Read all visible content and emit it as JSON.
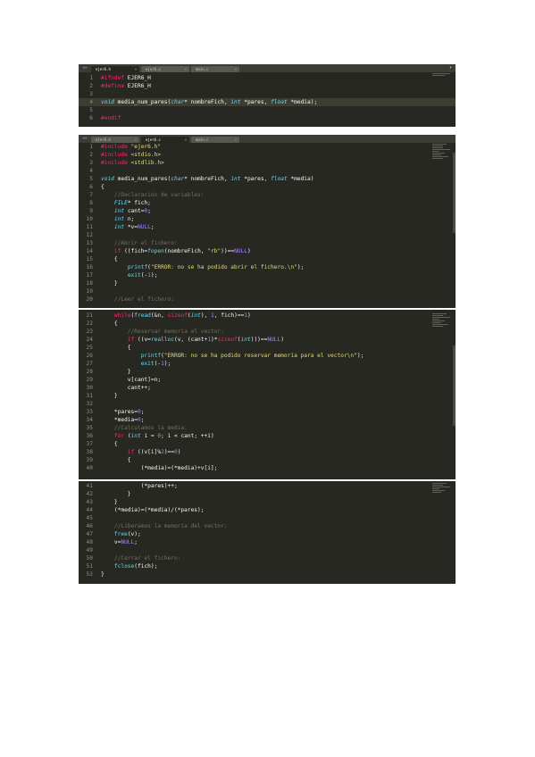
{
  "panels": [
    {
      "tabs": [
        "ejer6.h",
        "ejer6.c",
        "main.c"
      ],
      "active_tab": 0,
      "lines": [
        {
          "n": "1",
          "t": "#ifndef EJER6_H"
        },
        {
          "n": "2",
          "t": "#define EJER6_H"
        },
        {
          "n": "3",
          "t": ""
        },
        {
          "n": "4",
          "t": "void media_num_pares(char* nombreFich, int *pares, float *media);"
        },
        {
          "n": "5",
          "t": ""
        },
        {
          "n": "6",
          "t": "#endif"
        }
      ]
    },
    {
      "tabs": [
        "ejer6.h",
        "ejer6.c",
        "main.c"
      ],
      "active_tab": 1,
      "lines": [
        {
          "n": "1",
          "t": "#include \"ejer6.h\""
        },
        {
          "n": "2",
          "t": "#include <stdio.h>"
        },
        {
          "n": "3",
          "t": "#include <stdlib.h>"
        },
        {
          "n": "4",
          "t": ""
        },
        {
          "n": "5",
          "t": "void media_num_pares(char* nombreFich, int *pares, float *media)"
        },
        {
          "n": "6",
          "t": "{"
        },
        {
          "n": "7",
          "t": "    //Declaración de variables:"
        },
        {
          "n": "8",
          "t": "    FILE* fich;"
        },
        {
          "n": "9",
          "t": "    int cant=0;"
        },
        {
          "n": "10",
          "t": "    int n;"
        },
        {
          "n": "11",
          "t": "    int *v=NULL;"
        },
        {
          "n": "12",
          "t": ""
        },
        {
          "n": "13",
          "t": "    //Abrir el fichero:"
        },
        {
          "n": "14",
          "t": "    if ((fich=fopen(nombreFich, \"rb\"))==NULL)"
        },
        {
          "n": "15",
          "t": "    {"
        },
        {
          "n": "16",
          "t": "        printf(\"ERROR: no se ha podido abrir el fichero.\\n\");"
        },
        {
          "n": "17",
          "t": "        exit(-1);"
        },
        {
          "n": "18",
          "t": "    }"
        },
        {
          "n": "19",
          "t": ""
        },
        {
          "n": "20",
          "t": "    //Leer el fichero:"
        }
      ]
    },
    {
      "lines": [
        {
          "n": "21",
          "t": "    while(fread(&n, sizeof(int), 1, fich)==1)"
        },
        {
          "n": "22",
          "t": "    {"
        },
        {
          "n": "23",
          "t": "        //Reservar memoria el vector:"
        },
        {
          "n": "24",
          "t": "        if ((v=realloc(v, (cant+1)*sizeof(int)))==NULL)"
        },
        {
          "n": "25",
          "t": "        {"
        },
        {
          "n": "26",
          "t": "            printf(\"ERROR: no se ha podido reservar memoria para el vector\\n\");"
        },
        {
          "n": "27",
          "t": "            exit(-1);"
        },
        {
          "n": "28",
          "t": "        }"
        },
        {
          "n": "29",
          "t": "        v[cant]=n;"
        },
        {
          "n": "30",
          "t": "        cant++;"
        },
        {
          "n": "31",
          "t": "    }"
        },
        {
          "n": "32",
          "t": ""
        },
        {
          "n": "33",
          "t": "    *pares=0;"
        },
        {
          "n": "34",
          "t": "    *media=0;"
        },
        {
          "n": "35",
          "t": "    //Calculamos la media:"
        },
        {
          "n": "36",
          "t": "    for (int i = 0; i < cant; ++i)"
        },
        {
          "n": "37",
          "t": "    {"
        },
        {
          "n": "38",
          "t": "        if ((v[i]%2)==0)"
        },
        {
          "n": "39",
          "t": "        {"
        },
        {
          "n": "40",
          "t": "            (*media)=(*media)+v[i];"
        }
      ]
    },
    {
      "lines": [
        {
          "n": "41",
          "t": "            (*pares)++;"
        },
        {
          "n": "42",
          "t": "        }"
        },
        {
          "n": "43",
          "t": "    }"
        },
        {
          "n": "44",
          "t": "    (*media)=(*media)/(*pares);"
        },
        {
          "n": "45",
          "t": ""
        },
        {
          "n": "46",
          "t": "    //Liberamos la memoria del vector:"
        },
        {
          "n": "47",
          "t": "    free(v);"
        },
        {
          "n": "48",
          "t": "    v=NULL;"
        },
        {
          "n": "49",
          "t": ""
        },
        {
          "n": "50",
          "t": "    //Cerrar el fichero:"
        },
        {
          "n": "51",
          "t": "    fclose(fich);"
        },
        {
          "n": "52",
          "t": "}"
        }
      ]
    }
  ],
  "colors": {
    "background": "#272822",
    "text": "#f8f8f2",
    "keyword": "#f92672",
    "type": "#66d9ef",
    "string": "#e6db74",
    "number": "#ae81ff",
    "comment": "#75715e",
    "line_number": "#8f908a"
  }
}
